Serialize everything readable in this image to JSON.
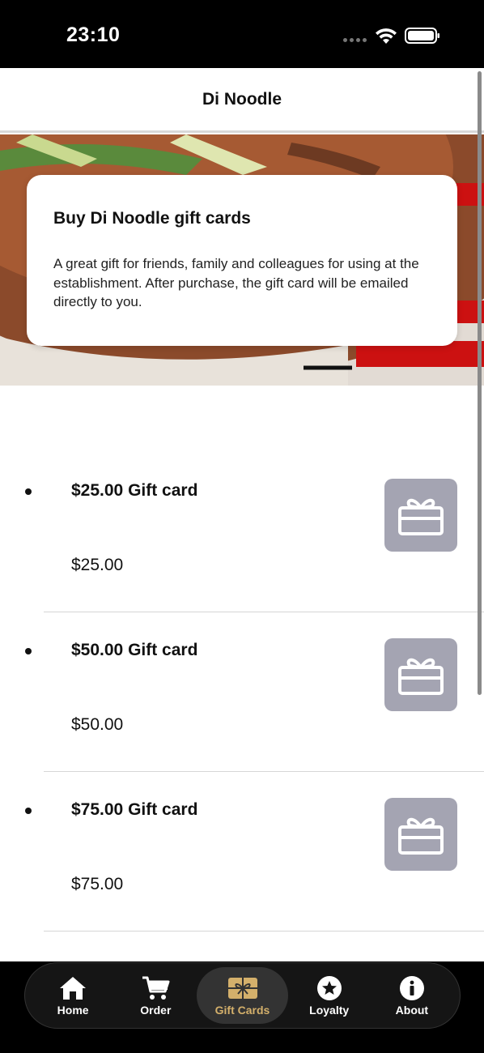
{
  "status_bar": {
    "time": "23:10"
  },
  "header": {
    "title": "Di Noodle"
  },
  "hero": {
    "card_title": "Buy Di Noodle gift cards",
    "card_text": "A great gift for friends, family and colleagues for using at the establishment. After purchase, the gift card will be emailed directly to you."
  },
  "gift_cards": [
    {
      "name": "$25.00 Gift card",
      "price": "$25.00",
      "icon": "gift-icon"
    },
    {
      "name": "$50.00 Gift card",
      "price": "$50.00",
      "icon": "gift-icon"
    },
    {
      "name": "$75.00 Gift card",
      "price": "$75.00",
      "icon": "gift-icon"
    }
  ],
  "tabs": [
    {
      "label": "Home",
      "icon": "home-icon",
      "active": false
    },
    {
      "label": "Order",
      "icon": "cart-icon",
      "active": false
    },
    {
      "label": "Gift Cards",
      "icon": "gift-card-icon",
      "active": true
    },
    {
      "label": "Loyalty",
      "icon": "star-icon",
      "active": false
    },
    {
      "label": "About",
      "icon": "info-icon",
      "active": false
    }
  ],
  "colors": {
    "accent": "#d4b06b",
    "thumb_bg": "#a4a4b2",
    "status_bar_bg": "#000000",
    "tab_bar_bg": "#151515"
  }
}
